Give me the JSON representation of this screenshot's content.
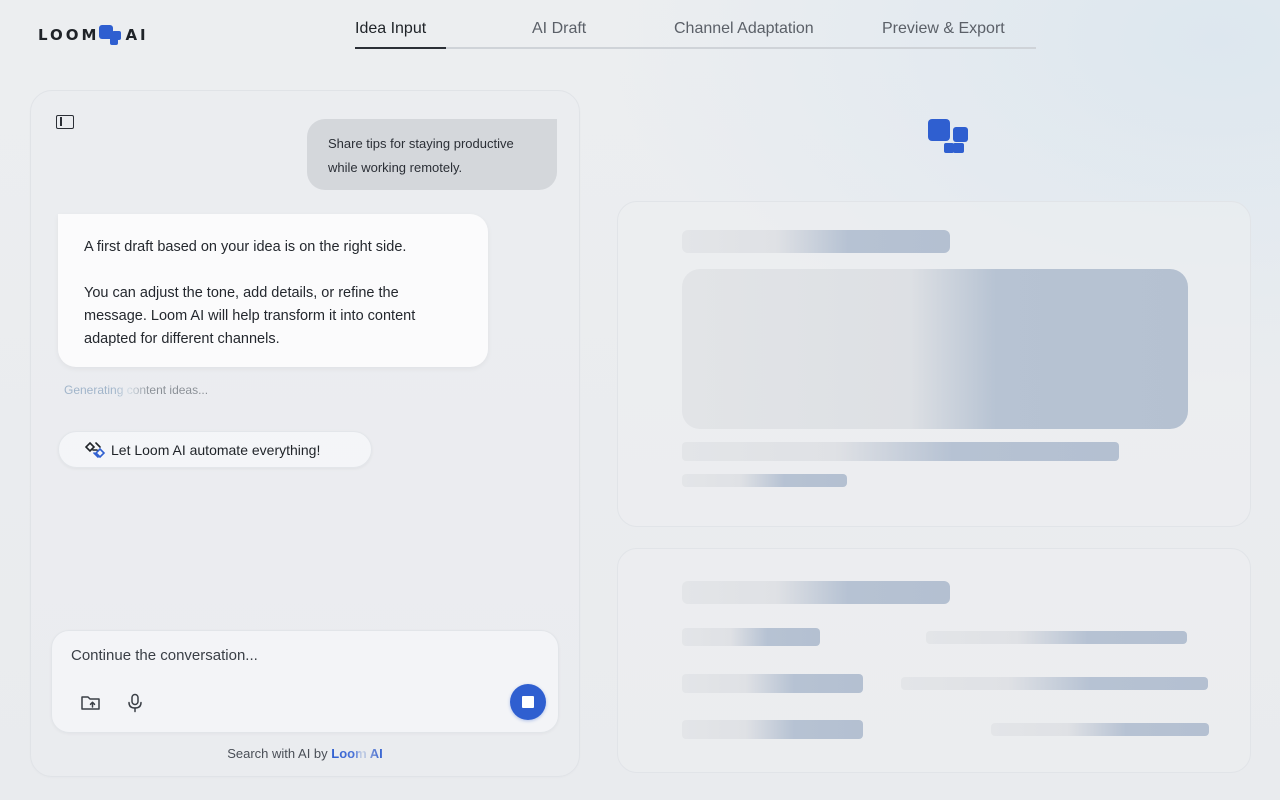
{
  "app": {
    "logo_left": "LOOM",
    "logo_right": "AI"
  },
  "tabs": [
    {
      "label": "Idea Input",
      "active": true
    },
    {
      "label": "AI Draft",
      "active": false
    },
    {
      "label": "Channel Adaptation",
      "active": false
    },
    {
      "label": "Preview & Export",
      "active": false
    }
  ],
  "chat": {
    "user_message": "Share tips for staying productive while working remotely.",
    "ai_message_p1": "A first draft based on your idea is on the right side.",
    "ai_message_p2": "You can adjust the tone, add details, or refine the message. Loom AI will help transform it into content adapted for different channels.",
    "status": "Generating content ideas...",
    "automate_label": "Let Loom AI automate everything!"
  },
  "composer": {
    "placeholder": "Continue the conversation...",
    "value": ""
  },
  "footer": {
    "prefix": "Search with AI by ",
    "brand": "Loom AI"
  },
  "colors": {
    "accent": "#2f5fd0",
    "skeleton_base": "#e2e4e7",
    "skeleton_highlight": "#b5c1d1"
  },
  "icons": {
    "sidebar_toggle": "sidebar-panel-icon",
    "automate": "sparkle-link-icon",
    "attach": "folder-upload-icon",
    "voice": "microphone-icon",
    "stop": "stop-square-icon"
  }
}
